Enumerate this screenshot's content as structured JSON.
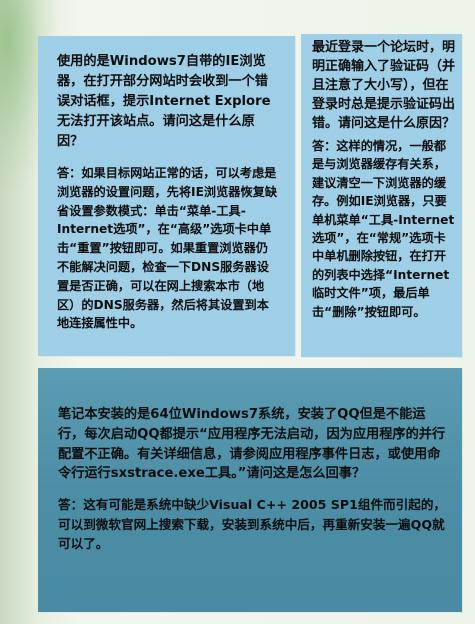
{
  "cards": {
    "left": {
      "question": "使用的是Windows7自带的IE浏览器，在打开部分网站时会收到一个错误对话框，提示Internet Explore无法打开该站点。请问这是什么原因？",
      "answer": "答：如果目标网站正常的话，可以考虑是浏览器的设置问题，先将IE浏览器恢复缺省设置参数模式：单击“菜单-工具-Internet选项”，在“高级”选项卡中单击“重置”按钮即可。如果重置浏览器仍不能解决问题，检查一下DNS服务器设置是否正确，可以在网上搜索本市（地区）的DNS服务器，然后将其设置到本地连接属性中。"
    },
    "right": {
      "question": "最近登录一个论坛时，明明正确输入了验证码（并且注意了大小写），但在登录时总是提示验证码出错。请问这是什么原因？",
      "answer": "答：这样的情况，一般都是与浏览器缓存有关系，建议清空一下浏览器的缓存。例如IE浏览器，只要单机菜单“工具-Internet选项”，在“常规”选项卡中单机删除按钮，在打开的列表中选择“Internet临时文件”项，最后单击“删除”按钮即可。"
    },
    "bottom": {
      "question": "笔记本安装的是64位Windows7系统，安装了QQ但是不能运行，每次启动QQ都提示“应用程序无法启动，因为应用程序的并行配置不正确。有关详细信息，请参阅应用程序事件日志，或使用命令行运行sxstrace.exe工具。”请问这是怎么回事？",
      "answer": "答：这有可能是系统中缺少Visual C++ 2005 SP1组件而引起的，可以到微软官网上搜索下载，安装到系统中后，再重新安装一遍QQ就可以了。"
    }
  }
}
